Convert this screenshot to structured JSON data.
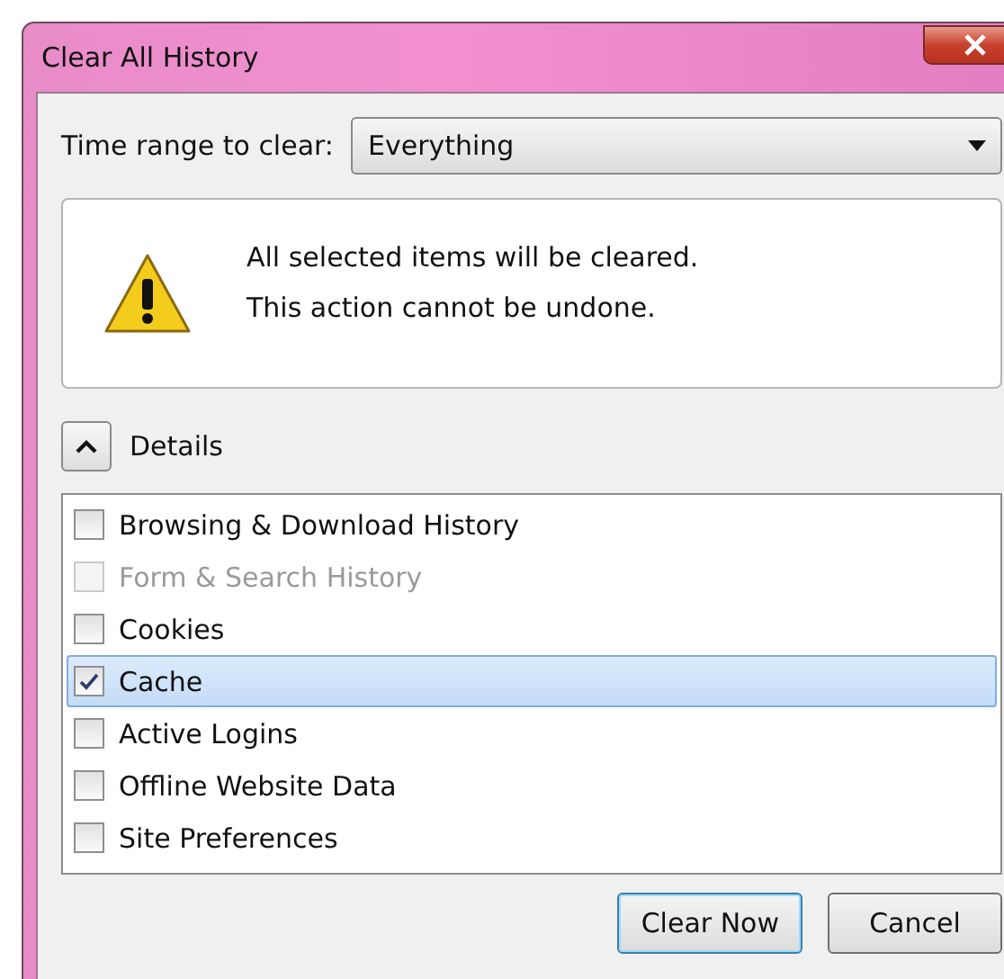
{
  "window": {
    "title": "Clear All History"
  },
  "time_range": {
    "label": "Time range to clear:",
    "value": "Everything"
  },
  "warning": {
    "lines": [
      "All selected items will be cleared.",
      "This action cannot be undone."
    ]
  },
  "details": {
    "label": "Details",
    "expanded": true
  },
  "items": [
    {
      "label": "Browsing & Download History",
      "checked": false,
      "disabled": false,
      "selected": false
    },
    {
      "label": "Form & Search History",
      "checked": false,
      "disabled": true,
      "selected": false
    },
    {
      "label": "Cookies",
      "checked": false,
      "disabled": false,
      "selected": false
    },
    {
      "label": "Cache",
      "checked": true,
      "disabled": false,
      "selected": true
    },
    {
      "label": "Active Logins",
      "checked": false,
      "disabled": false,
      "selected": false
    },
    {
      "label": "Offline Website Data",
      "checked": false,
      "disabled": false,
      "selected": false
    },
    {
      "label": "Site Preferences",
      "checked": false,
      "disabled": false,
      "selected": false
    }
  ],
  "buttons": [
    {
      "label": "Clear Now",
      "default": true
    },
    {
      "label": "Cancel",
      "default": false
    }
  ]
}
